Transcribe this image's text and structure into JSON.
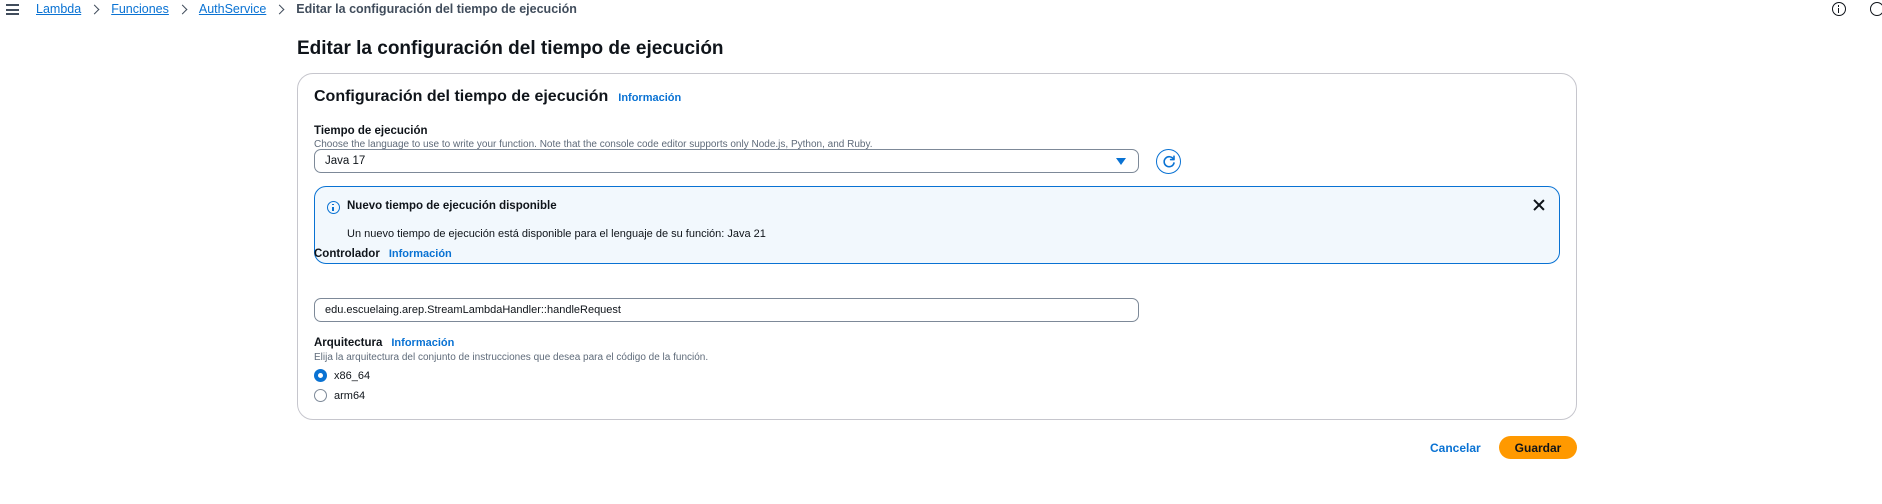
{
  "breadcrumb": {
    "items": [
      "Lambda",
      "Funciones",
      "AuthService"
    ],
    "current": "Editar la configuración del tiempo de ejecución"
  },
  "page": {
    "title": "Editar la configuración del tiempo de ejecución"
  },
  "container": {
    "title": "Configuración del tiempo de ejecución",
    "info_link": "Información"
  },
  "runtime": {
    "label": "Tiempo de ejecución",
    "description": "Choose the language to use to write your function. Note that the console code editor supports only Node.js, Python, and Ruby.",
    "selected": "Java 17"
  },
  "alert": {
    "title": "Nuevo tiempo de ejecución disponible",
    "body": "Un nuevo tiempo de ejecución está disponible para el lenguaje de su función: Java 21"
  },
  "handler": {
    "label": "Controlador",
    "info_link": "Información",
    "value": "edu.escuelaing.arep.StreamLambdaHandler::handleRequest"
  },
  "architecture": {
    "label": "Arquitectura",
    "info_link": "Información",
    "description": "Elija la arquitectura del conjunto de instrucciones que desea para el código de la función.",
    "options": [
      "x86_64",
      "arm64"
    ],
    "selected": "x86_64"
  },
  "actions": {
    "cancel_label": "Cancelar",
    "save_label": "Guardar"
  },
  "colors": {
    "accent": "#0972d3",
    "primary_button": "#ff9900",
    "alert_background": "#f2f8fd"
  }
}
